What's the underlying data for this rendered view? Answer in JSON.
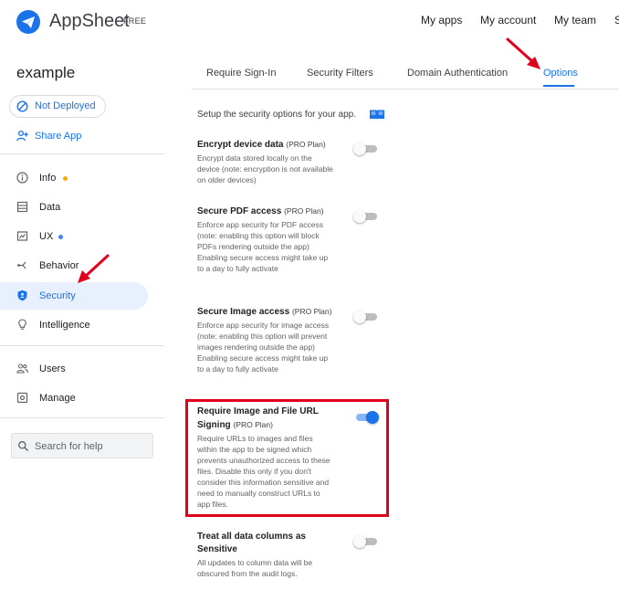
{
  "app": {
    "name": "AppSheet",
    "tier": "FREE"
  },
  "topnav": [
    {
      "label": "My apps"
    },
    {
      "label": "My account"
    },
    {
      "label": "My team"
    },
    {
      "label": "S"
    }
  ],
  "sidebar": {
    "app_title": "example",
    "status_chip": "Not Deployed",
    "share_label": "Share App",
    "items": [
      {
        "label": "Info",
        "icon": "info-icon",
        "badge": "orange-dot"
      },
      {
        "label": "Data",
        "icon": "table-icon"
      },
      {
        "label": "UX",
        "icon": "ux-icon",
        "badge": "blue-dot"
      },
      {
        "label": "Behavior",
        "icon": "behavior-icon"
      },
      {
        "label": "Security",
        "icon": "shield-icon",
        "active": true
      },
      {
        "label": "Intelligence",
        "icon": "lightbulb-icon"
      },
      {
        "label": "Users",
        "icon": "users-icon"
      },
      {
        "label": "Manage",
        "icon": "gear-icon"
      }
    ],
    "search_placeholder": "Search for help"
  },
  "tabs": [
    {
      "label": "Require Sign-In"
    },
    {
      "label": "Security Filters"
    },
    {
      "label": "Domain Authentication"
    },
    {
      "label": "Options",
      "active": true
    }
  ],
  "intro": "Setup the security options for your app.",
  "settings": [
    {
      "title": "Encrypt device data",
      "plan": "(PRO Plan)",
      "description": "Encrypt data stored locally on the device (note: encryption is not available on older devices)",
      "enabled": false
    },
    {
      "title": "Secure PDF access",
      "plan": "(PRO Plan)",
      "description": "Enforce app security for PDF access (note: enabling this option will block PDFs rendering outside the app) Enabling secure access might take up to a day to fully activate",
      "enabled": false
    },
    {
      "title": "Secure Image access",
      "plan": "(PRO Plan)",
      "description": "Enforce app security for image access (note: enabling this option will prevent images rendering outside the app) Enabling secure access might take up to a day to fully activate",
      "enabled": false
    },
    {
      "title": "Require Image and File URL Signing",
      "plan": "(PRO Plan)",
      "description": "Require URLs to images and files within the app to be signed which prevents unauthorized access to these files. Disable this only if you don't consider this information sensitive and need to manually construct URLs to app files.",
      "enabled": true
    },
    {
      "title": "Treat all data columns as Sensitive",
      "plan": "",
      "description": "All updates to column data will be obscured from the audit logs.",
      "enabled": false
    }
  ],
  "colors": {
    "accent": "#1a73e8",
    "annotation": "#e0001b",
    "orange_dot": "#f9ab00",
    "blue_dot": "#4285f4"
  }
}
